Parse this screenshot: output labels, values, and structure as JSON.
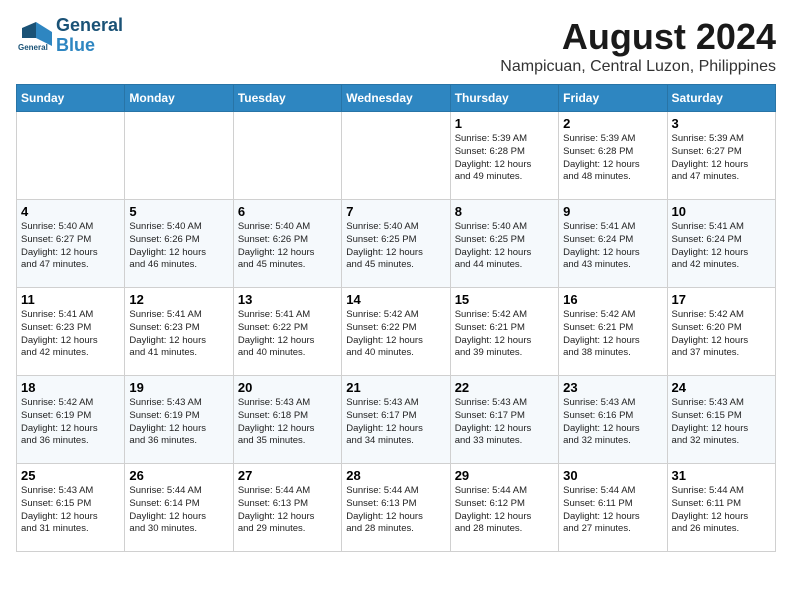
{
  "logo": {
    "line1": "General",
    "line2": "Blue"
  },
  "title": "August 2024",
  "location": "Nampicuan, Central Luzon, Philippines",
  "days_header": [
    "Sunday",
    "Monday",
    "Tuesday",
    "Wednesday",
    "Thursday",
    "Friday",
    "Saturday"
  ],
  "weeks": [
    [
      {
        "day": "",
        "content": ""
      },
      {
        "day": "",
        "content": ""
      },
      {
        "day": "",
        "content": ""
      },
      {
        "day": "",
        "content": ""
      },
      {
        "day": "1",
        "content": "Sunrise: 5:39 AM\nSunset: 6:28 PM\nDaylight: 12 hours\nand 49 minutes."
      },
      {
        "day": "2",
        "content": "Sunrise: 5:39 AM\nSunset: 6:28 PM\nDaylight: 12 hours\nand 48 minutes."
      },
      {
        "day": "3",
        "content": "Sunrise: 5:39 AM\nSunset: 6:27 PM\nDaylight: 12 hours\nand 47 minutes."
      }
    ],
    [
      {
        "day": "4",
        "content": "Sunrise: 5:40 AM\nSunset: 6:27 PM\nDaylight: 12 hours\nand 47 minutes."
      },
      {
        "day": "5",
        "content": "Sunrise: 5:40 AM\nSunset: 6:26 PM\nDaylight: 12 hours\nand 46 minutes."
      },
      {
        "day": "6",
        "content": "Sunrise: 5:40 AM\nSunset: 6:26 PM\nDaylight: 12 hours\nand 45 minutes."
      },
      {
        "day": "7",
        "content": "Sunrise: 5:40 AM\nSunset: 6:25 PM\nDaylight: 12 hours\nand 45 minutes."
      },
      {
        "day": "8",
        "content": "Sunrise: 5:40 AM\nSunset: 6:25 PM\nDaylight: 12 hours\nand 44 minutes."
      },
      {
        "day": "9",
        "content": "Sunrise: 5:41 AM\nSunset: 6:24 PM\nDaylight: 12 hours\nand 43 minutes."
      },
      {
        "day": "10",
        "content": "Sunrise: 5:41 AM\nSunset: 6:24 PM\nDaylight: 12 hours\nand 42 minutes."
      }
    ],
    [
      {
        "day": "11",
        "content": "Sunrise: 5:41 AM\nSunset: 6:23 PM\nDaylight: 12 hours\nand 42 minutes."
      },
      {
        "day": "12",
        "content": "Sunrise: 5:41 AM\nSunset: 6:23 PM\nDaylight: 12 hours\nand 41 minutes."
      },
      {
        "day": "13",
        "content": "Sunrise: 5:41 AM\nSunset: 6:22 PM\nDaylight: 12 hours\nand 40 minutes."
      },
      {
        "day": "14",
        "content": "Sunrise: 5:42 AM\nSunset: 6:22 PM\nDaylight: 12 hours\nand 40 minutes."
      },
      {
        "day": "15",
        "content": "Sunrise: 5:42 AM\nSunset: 6:21 PM\nDaylight: 12 hours\nand 39 minutes."
      },
      {
        "day": "16",
        "content": "Sunrise: 5:42 AM\nSunset: 6:21 PM\nDaylight: 12 hours\nand 38 minutes."
      },
      {
        "day": "17",
        "content": "Sunrise: 5:42 AM\nSunset: 6:20 PM\nDaylight: 12 hours\nand 37 minutes."
      }
    ],
    [
      {
        "day": "18",
        "content": "Sunrise: 5:42 AM\nSunset: 6:19 PM\nDaylight: 12 hours\nand 36 minutes."
      },
      {
        "day": "19",
        "content": "Sunrise: 5:43 AM\nSunset: 6:19 PM\nDaylight: 12 hours\nand 36 minutes."
      },
      {
        "day": "20",
        "content": "Sunrise: 5:43 AM\nSunset: 6:18 PM\nDaylight: 12 hours\nand 35 minutes."
      },
      {
        "day": "21",
        "content": "Sunrise: 5:43 AM\nSunset: 6:17 PM\nDaylight: 12 hours\nand 34 minutes."
      },
      {
        "day": "22",
        "content": "Sunrise: 5:43 AM\nSunset: 6:17 PM\nDaylight: 12 hours\nand 33 minutes."
      },
      {
        "day": "23",
        "content": "Sunrise: 5:43 AM\nSunset: 6:16 PM\nDaylight: 12 hours\nand 32 minutes."
      },
      {
        "day": "24",
        "content": "Sunrise: 5:43 AM\nSunset: 6:15 PM\nDaylight: 12 hours\nand 32 minutes."
      }
    ],
    [
      {
        "day": "25",
        "content": "Sunrise: 5:43 AM\nSunset: 6:15 PM\nDaylight: 12 hours\nand 31 minutes."
      },
      {
        "day": "26",
        "content": "Sunrise: 5:44 AM\nSunset: 6:14 PM\nDaylight: 12 hours\nand 30 minutes."
      },
      {
        "day": "27",
        "content": "Sunrise: 5:44 AM\nSunset: 6:13 PM\nDaylight: 12 hours\nand 29 minutes."
      },
      {
        "day": "28",
        "content": "Sunrise: 5:44 AM\nSunset: 6:13 PM\nDaylight: 12 hours\nand 28 minutes."
      },
      {
        "day": "29",
        "content": "Sunrise: 5:44 AM\nSunset: 6:12 PM\nDaylight: 12 hours\nand 28 minutes."
      },
      {
        "day": "30",
        "content": "Sunrise: 5:44 AM\nSunset: 6:11 PM\nDaylight: 12 hours\nand 27 minutes."
      },
      {
        "day": "31",
        "content": "Sunrise: 5:44 AM\nSunset: 6:11 PM\nDaylight: 12 hours\nand 26 minutes."
      }
    ]
  ]
}
